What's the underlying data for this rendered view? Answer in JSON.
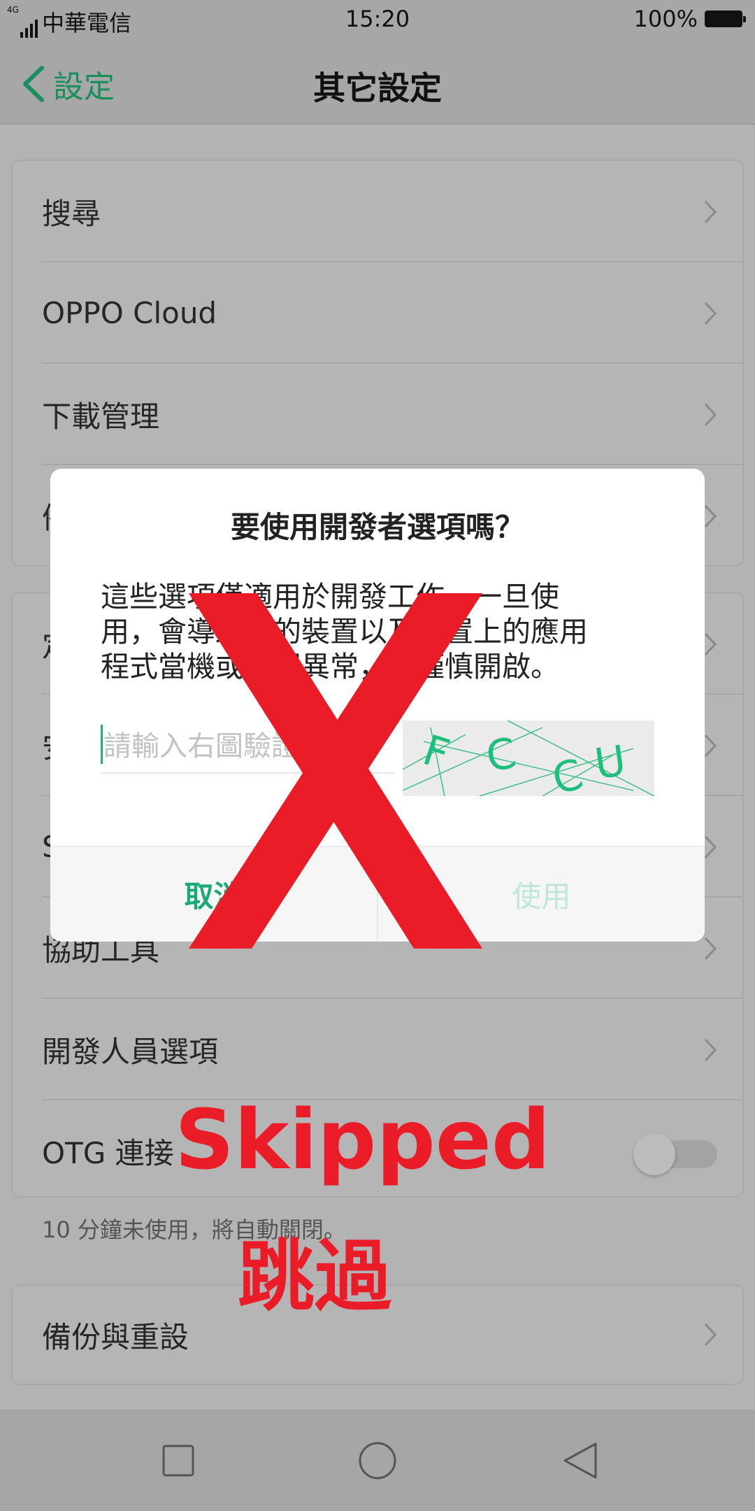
{
  "status_bar": {
    "network": "4G",
    "carrier": "中華電信",
    "time": "15:20",
    "battery": "100%"
  },
  "header": {
    "back_label": "設定",
    "title": "其它設定"
  },
  "settings": {
    "group1": [
      {
        "label": "搜尋"
      },
      {
        "label": "OPPO Cloud"
      },
      {
        "label": "下載管理"
      },
      {
        "label": "備"
      }
    ],
    "group2": [
      {
        "label": "定"
      },
      {
        "label": "安"
      },
      {
        "label": "S"
      },
      {
        "label": "協助工具"
      },
      {
        "label": "開發人員選項"
      },
      {
        "label": "OTG 連接",
        "toggle_on": false
      }
    ],
    "note": "10 分鐘未使用，將自動關閉。",
    "group3": [
      {
        "label": "備份與重設"
      }
    ]
  },
  "dialog": {
    "title": "要使用開發者選項嗎？",
    "body_lines": [
      "這些選項僅適用於開發工作，一旦使",
      "用，會導致您的裝置以及裝置上的應用",
      "程式當機或出現異常，請謹慎開啟。"
    ],
    "captcha_placeholder": "請輸入右圖驗證碼",
    "captcha_text": "FCCU",
    "cancel_label": "取消",
    "confirm_label": "使用"
  },
  "annotation": {
    "mark": "X",
    "text_en": "Skipped",
    "text_zh": "跳過",
    "color": "#e91c28"
  },
  "colors": {
    "accent": "#1ca97a",
    "dim_background": "#b3b3b3"
  },
  "navbar_icons": [
    "recent-apps-icon",
    "home-icon",
    "back-icon"
  ]
}
